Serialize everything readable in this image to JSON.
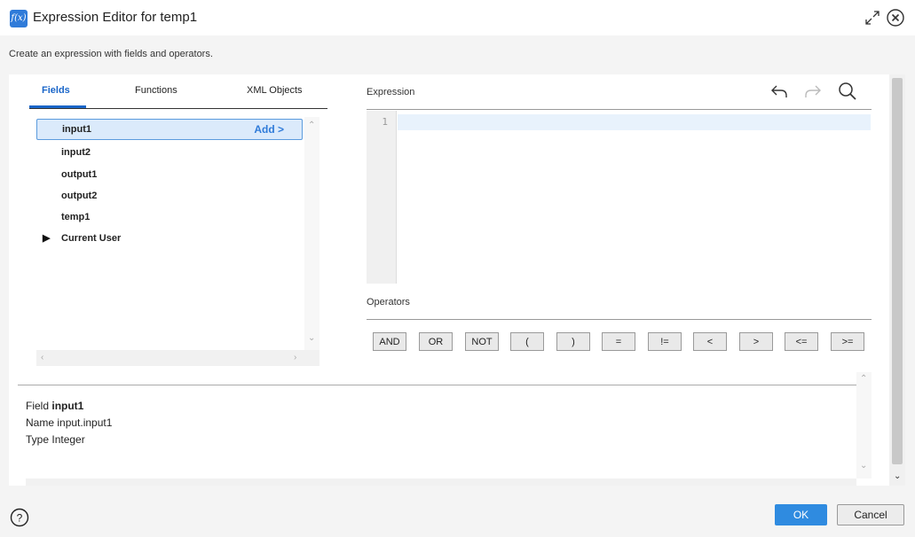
{
  "window": {
    "icon_label": "f(x)",
    "title": "Expression Editor for temp1",
    "subtitle": "Create an expression with fields and operators."
  },
  "tabs": [
    {
      "label": "Fields",
      "active": true
    },
    {
      "label": "Functions",
      "active": false
    },
    {
      "label": "XML Objects",
      "active": false
    }
  ],
  "fields": {
    "items": [
      {
        "label": "input1",
        "selected": true,
        "action": "Add >"
      },
      {
        "label": "input2"
      },
      {
        "label": "output1"
      },
      {
        "label": "output2"
      },
      {
        "label": "temp1"
      },
      {
        "label": "Current User",
        "expandable": true
      }
    ]
  },
  "expression": {
    "label": "Expression",
    "line_number": "1",
    "content": "",
    "toolbar": [
      "undo-icon",
      "redo-icon",
      "search-icon"
    ]
  },
  "operators": {
    "label": "Operators",
    "items": [
      "AND",
      "OR",
      "NOT",
      "(",
      ")",
      "=",
      "!=",
      "<",
      ">",
      "<=",
      ">="
    ]
  },
  "info": {
    "field_label": "Field",
    "field_value": "input1",
    "name_label": "Name",
    "name_value": "input.input1",
    "type_label": "Type",
    "type_value": "Integer"
  },
  "footer": {
    "ok_label": "OK",
    "cancel_label": "Cancel"
  },
  "colors": {
    "accent": "#2f8be0",
    "selection": "#dbeafb",
    "tab_active": "#1a66c9"
  }
}
